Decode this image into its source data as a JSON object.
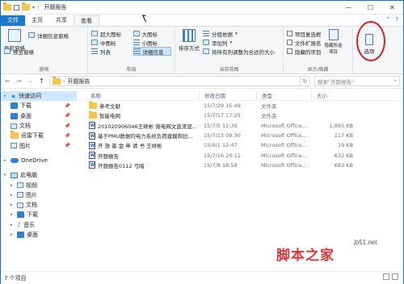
{
  "window": {
    "title": "开题报告",
    "buttons": {
      "minimize": "—",
      "maximize": "☐",
      "close": "✕"
    }
  },
  "tabs": [
    {
      "label": "文件"
    },
    {
      "label": "主页"
    },
    {
      "label": "共享"
    },
    {
      "label": "查看"
    }
  ],
  "tabs_right": {
    "expand": "⌃",
    "help": "?"
  },
  "ribbon": {
    "pane": {
      "nav_pane": "导航窗格",
      "preview_pane": "预览窗格",
      "details_pane": "详细信息窗格",
      "label": "窗格"
    },
    "layout": {
      "options": [
        "超大图标",
        "大图标",
        "中图标",
        "小图标",
        "列表",
        "详细信息"
      ],
      "selected": "详细信息",
      "label": "布局"
    },
    "current_view": {
      "sort": "排序方式",
      "group_by": "分组依据",
      "add_column": "添加列",
      "fit_columns": "将所有列调整为合适的大小",
      "label": "当前视图"
    },
    "show_hide": {
      "item_checkbox": "项目复选框",
      "file_ext": "文件扩展名",
      "hidden_items": "隐藏的项目",
      "hide_selected": "隐藏所选项目",
      "label": "显示/隐藏"
    },
    "options": {
      "label": "选项"
    }
  },
  "address": {
    "back": "←",
    "forward": "→",
    "up_list": "⌄",
    "up": "↑",
    "path": "开题报告",
    "refresh": "↻",
    "search_placeholder": "搜索\"开题报告\"",
    "search_icon": "⌕"
  },
  "nav": {
    "quick_access": "快速访问",
    "items": [
      {
        "label": "下载",
        "pinned": true
      },
      {
        "label": "桌面",
        "pinned": true
      },
      {
        "label": "文档",
        "pinned": true
      },
      {
        "label": "迅雷下载",
        "pinned": true
      },
      {
        "label": "图片",
        "pinned": true
      }
    ],
    "onedrive": "OneDrive",
    "this_pc": "此电脑",
    "pc_items": [
      {
        "label": "视频"
      },
      {
        "label": "图片"
      },
      {
        "label": "文档"
      },
      {
        "label": "下载"
      },
      {
        "label": "音乐"
      },
      {
        "label": "桌面"
      }
    ]
  },
  "columns": {
    "name": "名称",
    "date": "修改日期",
    "type": "类型",
    "size": "大小"
  },
  "files": [
    {
      "name": "参考文献",
      "date": "15/7/29 15:49",
      "type": "文件夹",
      "size": "",
      "kind": "folder"
    },
    {
      "name": "智能电网",
      "date": "15/7/17 17:25",
      "type": "文件夹",
      "size": "",
      "kind": "folder"
    },
    {
      "name": "201020906046王继彬 微电网文直流混...",
      "date": "15/7/5 12:39",
      "type": "Microsoft Office...",
      "size": "1,885 KB",
      "kind": "doc"
    },
    {
      "name": "基于PMU数据的电力系统负荷建模和拉...",
      "date": "15/7/13 09:30",
      "type": "Microsoft Office...",
      "size": "117 KB",
      "kind": "doc"
    },
    {
      "name": "开 放 基 金 申 请 书  王继彬",
      "date": "15/9/1 12:47",
      "type": "Microsoft Office...",
      "size": "19 KB",
      "kind": "doc"
    },
    {
      "name": "开题报告",
      "date": "15/7/16 20:11",
      "type": "Microsoft Office...",
      "size": "632 KB",
      "kind": "doc"
    },
    {
      "name": "开题报告0112 弓暗",
      "date": "15/7/8 18:58",
      "type": "Microsoft Office...",
      "size": "683 KB",
      "kind": "doc"
    }
  ],
  "status": {
    "count": "7 个项目"
  },
  "watermark": {
    "text": "脚本之家",
    "site": "jb51.net"
  }
}
